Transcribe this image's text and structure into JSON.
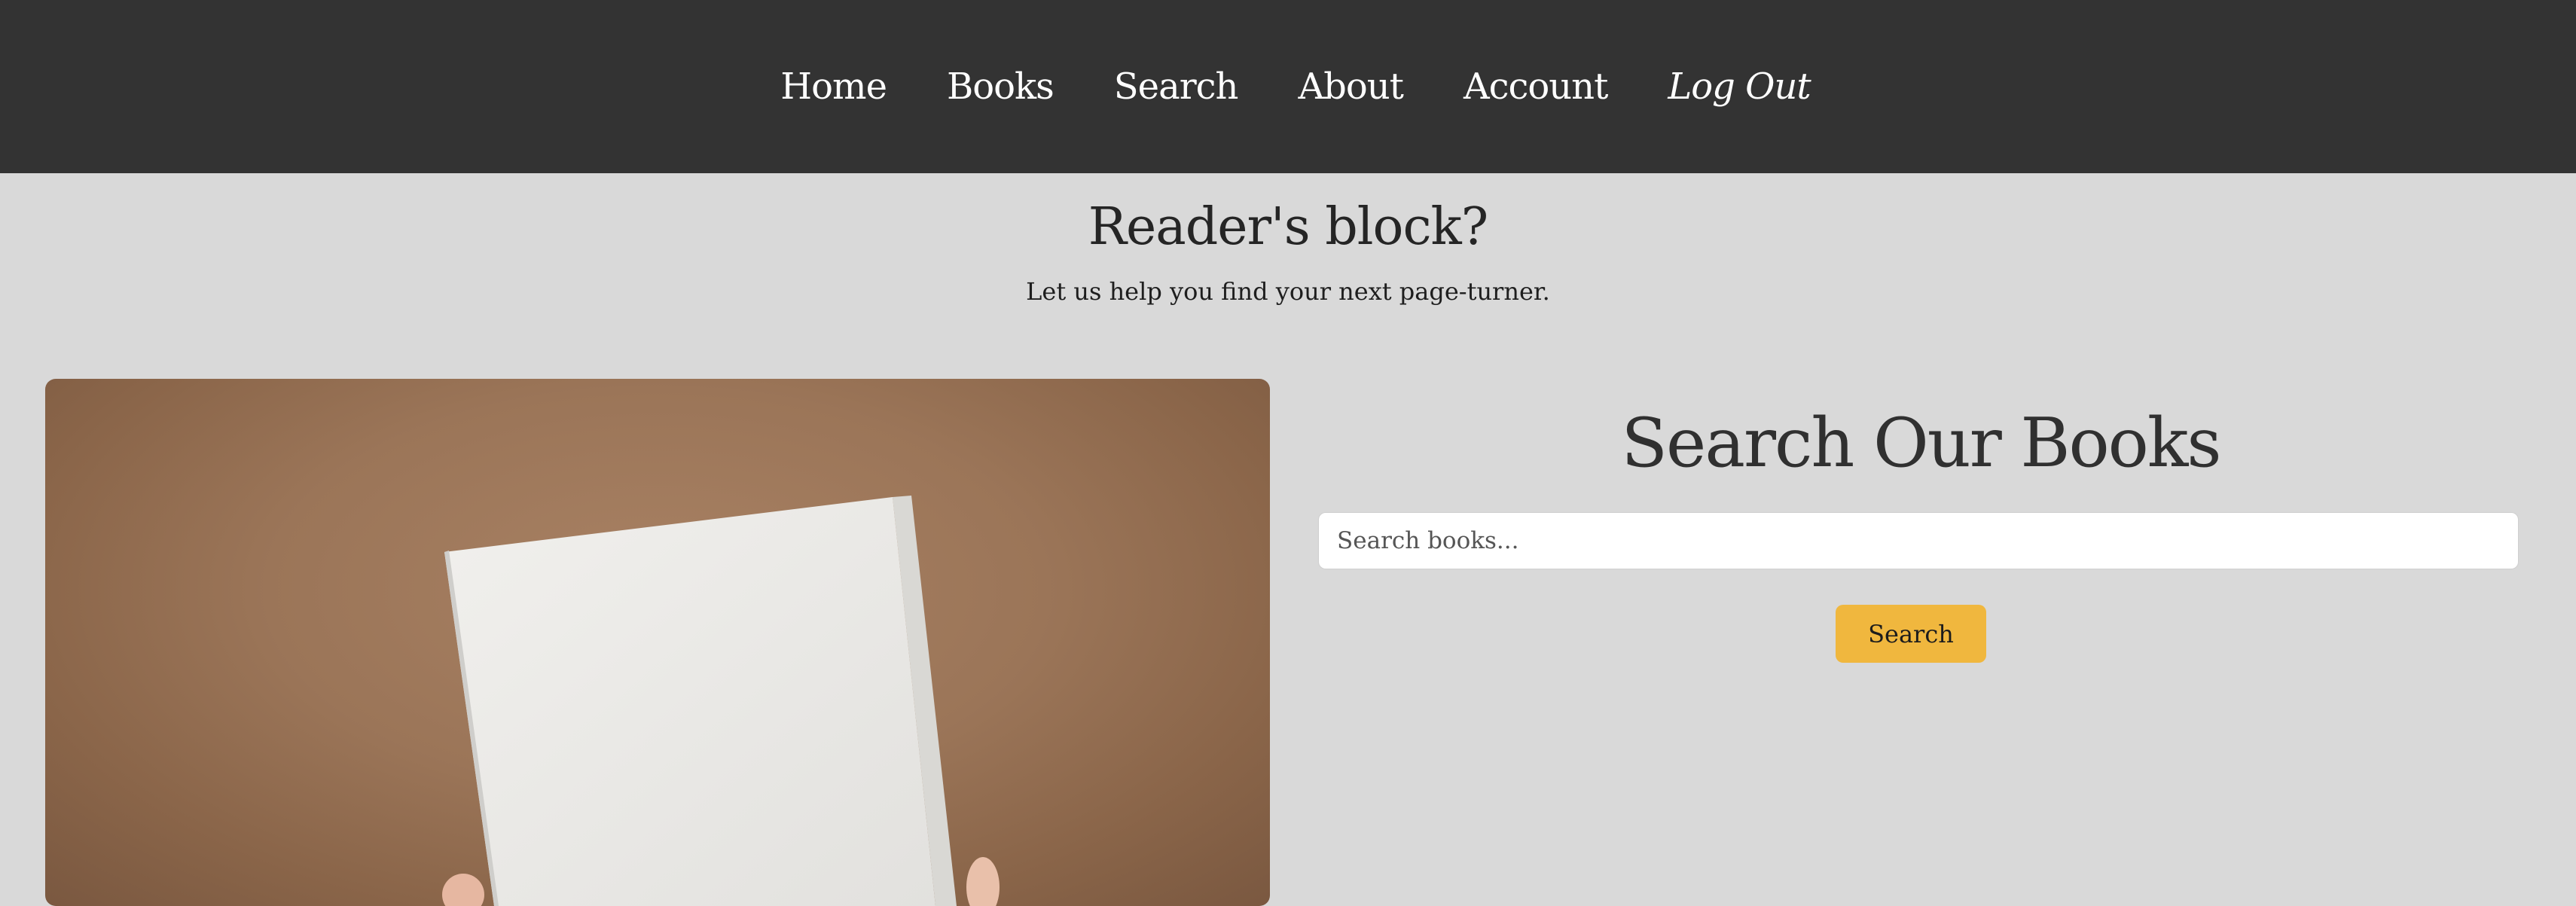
{
  "nav": {
    "items": [
      {
        "label": "Home"
      },
      {
        "label": "Books"
      },
      {
        "label": "Search"
      },
      {
        "label": "About"
      },
      {
        "label": "Account"
      },
      {
        "label": "Log Out"
      }
    ]
  },
  "hero": {
    "title": "Reader's block?",
    "subtitle": "Let us help you find your next page-turner."
  },
  "search": {
    "title": "Search Our Books",
    "placeholder": "Search books...",
    "button_label": "Search"
  },
  "colors": {
    "navbar": "#333333",
    "page_background": "#d9d9d9",
    "accent": "#f0b73e"
  }
}
